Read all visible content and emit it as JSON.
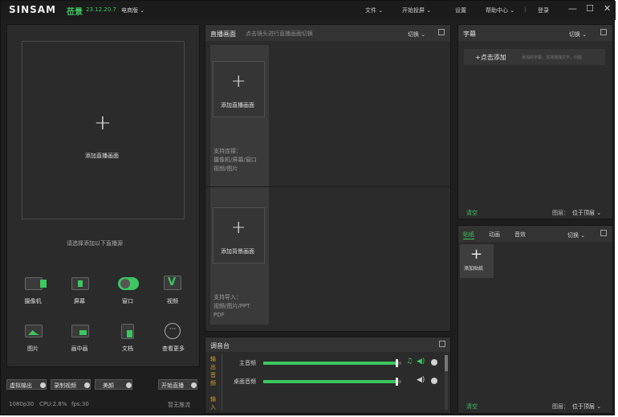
{
  "titlebar": {
    "logo": "SINSAM",
    "logo_cn": "莅景",
    "version": "23.12.20.7",
    "edition": "电商版 ⌄",
    "menu_file": "文件 ⌄",
    "menu_start_cast": "开始投屏 ⌄",
    "menu_settings": "设置",
    "menu_help": "帮助中心 ⌄",
    "menu_login": "登录",
    "min_glyph": "—",
    "max_glyph": "☐",
    "close_glyph": "✕"
  },
  "left": {
    "plus": "+",
    "add_live": "添加直播画面",
    "choose_source": "请选择添加以下直播源",
    "sources": [
      {
        "label": "摄像机",
        "icon": "camera-icon"
      },
      {
        "label": "屏幕",
        "icon": "screen-icon"
      },
      {
        "label": "窗口",
        "icon": "window-icon"
      },
      {
        "label": "视频",
        "icon": "video-icon"
      },
      {
        "label": "图片",
        "icon": "image-icon"
      },
      {
        "label": "画中画",
        "icon": "pip-icon"
      },
      {
        "label": "文档",
        "icon": "document-icon"
      },
      {
        "label": "查看更多",
        "icon": "more-icon"
      }
    ],
    "btn_virtual_output": "虚拟输出",
    "btn_record": "录制视频",
    "btn_beauty": "美颜",
    "btn_start_live": "开始直播",
    "status_res": "1080p30",
    "status_cpu": "CPU:2.8%",
    "status_fps": "fps:30",
    "status_stream": "暂无推流"
  },
  "middle": {
    "title": "直播画面",
    "hint": "点击镜头进行直播画面切换",
    "switch": "切换 ⌄",
    "card1_plus": "+",
    "card1_label": "添加直播画面",
    "card1_desc1": "支持连接：",
    "card1_desc2": "摄像机/屏幕/窗口",
    "card1_desc3": "视频/图片",
    "card2_plus": "+",
    "card2_label": "添加背景画面",
    "card2_desc1": "支持导入：",
    "card2_desc2": "视频/图片/PPT",
    "card2_desc3": "PDF"
  },
  "mixer": {
    "title": "调音台",
    "output_label": "输出音频",
    "input_label": "输入",
    "main_audio": "主音频",
    "desktop_audio": "桌面音频",
    "main_level": 0.97,
    "desktop_level": 0.97
  },
  "subtitle": {
    "title": "字幕",
    "switch": "切换 ⌄",
    "add": "+点击添加",
    "add_hint": "添加的字幕，支持拖拽文字，问题",
    "clear": "清空",
    "layer": "图层：",
    "layer_value": "位于顶层 ⌄"
  },
  "sticker": {
    "tab_sticker": "贴纸",
    "tab_animation": "动画",
    "tab_sound": "音效",
    "switch": "切换 ⌄",
    "plus": "+",
    "add_label": "添加贴纸",
    "clear": "清空",
    "layer": "图层：",
    "layer_value": "位于顶层 ⌄"
  }
}
